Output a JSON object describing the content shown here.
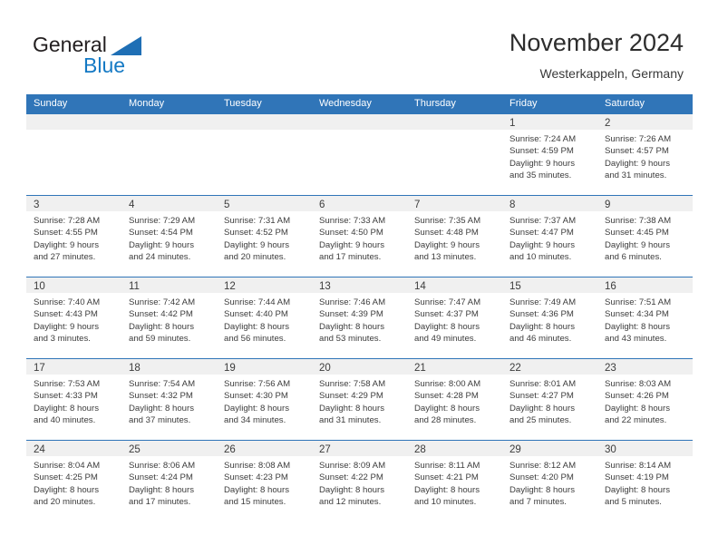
{
  "brand": {
    "name_part1": "General",
    "name_part2": "Blue",
    "triangle_color": "#1f6fb5",
    "blue_text_color": "#1479c4"
  },
  "header": {
    "title": "November 2024",
    "location": "Westerkappeln, Germany"
  },
  "theme": {
    "header_blue": "#3075b8",
    "daynum_band_gray": "#f0f0f0",
    "text_color": "#3c3c3c",
    "page_background": "#ffffff"
  },
  "calendar": {
    "weekday_headers": [
      "Sunday",
      "Monday",
      "Tuesday",
      "Wednesday",
      "Thursday",
      "Friday",
      "Saturday"
    ],
    "weeks": [
      [
        {
          "day": "",
          "lines": []
        },
        {
          "day": "",
          "lines": []
        },
        {
          "day": "",
          "lines": []
        },
        {
          "day": "",
          "lines": []
        },
        {
          "day": "",
          "lines": []
        },
        {
          "day": "1",
          "lines": [
            "Sunrise: 7:24 AM",
            "Sunset: 4:59 PM",
            "Daylight: 9 hours",
            "and 35 minutes."
          ]
        },
        {
          "day": "2",
          "lines": [
            "Sunrise: 7:26 AM",
            "Sunset: 4:57 PM",
            "Daylight: 9 hours",
            "and 31 minutes."
          ]
        }
      ],
      [
        {
          "day": "3",
          "lines": [
            "Sunrise: 7:28 AM",
            "Sunset: 4:55 PM",
            "Daylight: 9 hours",
            "and 27 minutes."
          ]
        },
        {
          "day": "4",
          "lines": [
            "Sunrise: 7:29 AM",
            "Sunset: 4:54 PM",
            "Daylight: 9 hours",
            "and 24 minutes."
          ]
        },
        {
          "day": "5",
          "lines": [
            "Sunrise: 7:31 AM",
            "Sunset: 4:52 PM",
            "Daylight: 9 hours",
            "and 20 minutes."
          ]
        },
        {
          "day": "6",
          "lines": [
            "Sunrise: 7:33 AM",
            "Sunset: 4:50 PM",
            "Daylight: 9 hours",
            "and 17 minutes."
          ]
        },
        {
          "day": "7",
          "lines": [
            "Sunrise: 7:35 AM",
            "Sunset: 4:48 PM",
            "Daylight: 9 hours",
            "and 13 minutes."
          ]
        },
        {
          "day": "8",
          "lines": [
            "Sunrise: 7:37 AM",
            "Sunset: 4:47 PM",
            "Daylight: 9 hours",
            "and 10 minutes."
          ]
        },
        {
          "day": "9",
          "lines": [
            "Sunrise: 7:38 AM",
            "Sunset: 4:45 PM",
            "Daylight: 9 hours",
            "and 6 minutes."
          ]
        }
      ],
      [
        {
          "day": "10",
          "lines": [
            "Sunrise: 7:40 AM",
            "Sunset: 4:43 PM",
            "Daylight: 9 hours",
            "and 3 minutes."
          ]
        },
        {
          "day": "11",
          "lines": [
            "Sunrise: 7:42 AM",
            "Sunset: 4:42 PM",
            "Daylight: 8 hours",
            "and 59 minutes."
          ]
        },
        {
          "day": "12",
          "lines": [
            "Sunrise: 7:44 AM",
            "Sunset: 4:40 PM",
            "Daylight: 8 hours",
            "and 56 minutes."
          ]
        },
        {
          "day": "13",
          "lines": [
            "Sunrise: 7:46 AM",
            "Sunset: 4:39 PM",
            "Daylight: 8 hours",
            "and 53 minutes."
          ]
        },
        {
          "day": "14",
          "lines": [
            "Sunrise: 7:47 AM",
            "Sunset: 4:37 PM",
            "Daylight: 8 hours",
            "and 49 minutes."
          ]
        },
        {
          "day": "15",
          "lines": [
            "Sunrise: 7:49 AM",
            "Sunset: 4:36 PM",
            "Daylight: 8 hours",
            "and 46 minutes."
          ]
        },
        {
          "day": "16",
          "lines": [
            "Sunrise: 7:51 AM",
            "Sunset: 4:34 PM",
            "Daylight: 8 hours",
            "and 43 minutes."
          ]
        }
      ],
      [
        {
          "day": "17",
          "lines": [
            "Sunrise: 7:53 AM",
            "Sunset: 4:33 PM",
            "Daylight: 8 hours",
            "and 40 minutes."
          ]
        },
        {
          "day": "18",
          "lines": [
            "Sunrise: 7:54 AM",
            "Sunset: 4:32 PM",
            "Daylight: 8 hours",
            "and 37 minutes."
          ]
        },
        {
          "day": "19",
          "lines": [
            "Sunrise: 7:56 AM",
            "Sunset: 4:30 PM",
            "Daylight: 8 hours",
            "and 34 minutes."
          ]
        },
        {
          "day": "20",
          "lines": [
            "Sunrise: 7:58 AM",
            "Sunset: 4:29 PM",
            "Daylight: 8 hours",
            "and 31 minutes."
          ]
        },
        {
          "day": "21",
          "lines": [
            "Sunrise: 8:00 AM",
            "Sunset: 4:28 PM",
            "Daylight: 8 hours",
            "and 28 minutes."
          ]
        },
        {
          "day": "22",
          "lines": [
            "Sunrise: 8:01 AM",
            "Sunset: 4:27 PM",
            "Daylight: 8 hours",
            "and 25 minutes."
          ]
        },
        {
          "day": "23",
          "lines": [
            "Sunrise: 8:03 AM",
            "Sunset: 4:26 PM",
            "Daylight: 8 hours",
            "and 22 minutes."
          ]
        }
      ],
      [
        {
          "day": "24",
          "lines": [
            "Sunrise: 8:04 AM",
            "Sunset: 4:25 PM",
            "Daylight: 8 hours",
            "and 20 minutes."
          ]
        },
        {
          "day": "25",
          "lines": [
            "Sunrise: 8:06 AM",
            "Sunset: 4:24 PM",
            "Daylight: 8 hours",
            "and 17 minutes."
          ]
        },
        {
          "day": "26",
          "lines": [
            "Sunrise: 8:08 AM",
            "Sunset: 4:23 PM",
            "Daylight: 8 hours",
            "and 15 minutes."
          ]
        },
        {
          "day": "27",
          "lines": [
            "Sunrise: 8:09 AM",
            "Sunset: 4:22 PM",
            "Daylight: 8 hours",
            "and 12 minutes."
          ]
        },
        {
          "day": "28",
          "lines": [
            "Sunrise: 8:11 AM",
            "Sunset: 4:21 PM",
            "Daylight: 8 hours",
            "and 10 minutes."
          ]
        },
        {
          "day": "29",
          "lines": [
            "Sunrise: 8:12 AM",
            "Sunset: 4:20 PM",
            "Daylight: 8 hours",
            "and 7 minutes."
          ]
        },
        {
          "day": "30",
          "lines": [
            "Sunrise: 8:14 AM",
            "Sunset: 4:19 PM",
            "Daylight: 8 hours",
            "and 5 minutes."
          ]
        }
      ]
    ]
  }
}
